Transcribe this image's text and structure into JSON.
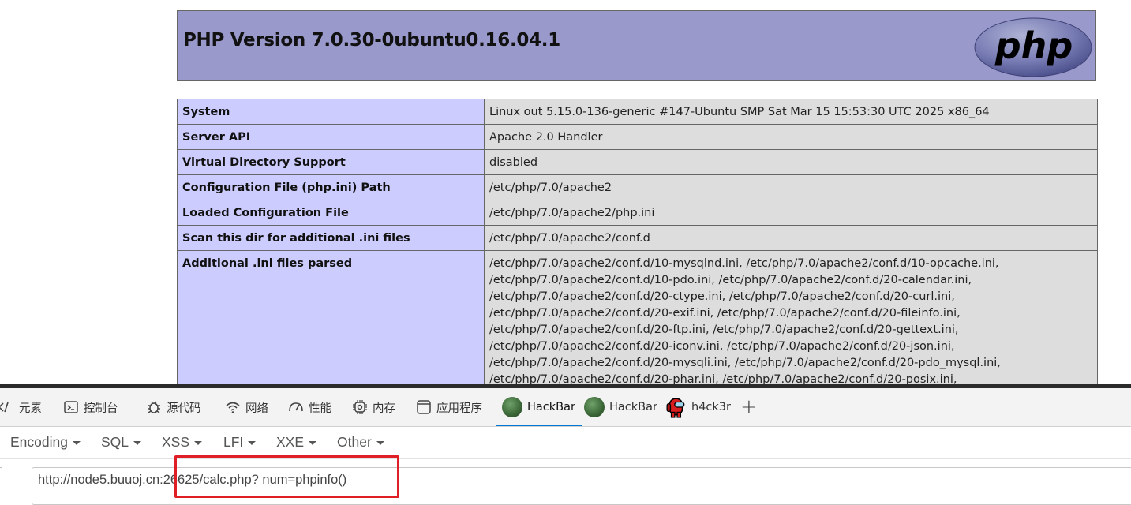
{
  "php": {
    "title": "PHP Version 7.0.30-0ubuntu0.16.04.1",
    "logo_text": "php",
    "rows": [
      {
        "key": "System",
        "value": "Linux out 5.15.0-136-generic #147-Ubuntu SMP Sat Mar 15 15:53:30 UTC 2025 x86_64"
      },
      {
        "key": "Server API",
        "value": "Apache 2.0 Handler"
      },
      {
        "key": "Virtual Directory Support",
        "value": "disabled"
      },
      {
        "key": "Configuration File (php.ini) Path",
        "value": "/etc/php/7.0/apache2"
      },
      {
        "key": "Loaded Configuration File",
        "value": "/etc/php/7.0/apache2/php.ini"
      },
      {
        "key": "Scan this dir for additional .ini files",
        "value": "/etc/php/7.0/apache2/conf.d"
      }
    ],
    "ini_parsed_key": "Additional .ini files parsed",
    "ini_parsed_lines": [
      "/etc/php/7.0/apache2/conf.d/10-mysqlnd.ini, /etc/php/7.0/apache2/conf.d/10-opcache.ini,",
      "/etc/php/7.0/apache2/conf.d/10-pdo.ini, /etc/php/7.0/apache2/conf.d/20-calendar.ini,",
      "/etc/php/7.0/apache2/conf.d/20-ctype.ini, /etc/php/7.0/apache2/conf.d/20-curl.ini,",
      "/etc/php/7.0/apache2/conf.d/20-exif.ini, /etc/php/7.0/apache2/conf.d/20-fileinfo.ini,",
      "/etc/php/7.0/apache2/conf.d/20-ftp.ini, /etc/php/7.0/apache2/conf.d/20-gettext.ini,",
      "/etc/php/7.0/apache2/conf.d/20-iconv.ini, /etc/php/7.0/apache2/conf.d/20-json.ini,",
      "/etc/php/7.0/apache2/conf.d/20-mysqli.ini, /etc/php/7.0/apache2/conf.d/20-pdo_mysql.ini,",
      "/etc/php/7.0/apache2/conf.d/20-phar.ini, /etc/php/7.0/apache2/conf.d/20-posix.ini,"
    ]
  },
  "devtools": {
    "tabs": [
      {
        "label": "元素",
        "icon": "code-icon"
      },
      {
        "label": "控制台",
        "icon": "console-icon"
      },
      {
        "label": "源代码",
        "icon": "bug-icon"
      },
      {
        "label": "网络",
        "icon": "wifi-icon"
      },
      {
        "label": "性能",
        "icon": "gauge-icon"
      },
      {
        "label": "内存",
        "icon": "chip-icon"
      },
      {
        "label": "应用程序",
        "icon": "app-icon"
      },
      {
        "label": "HackBar",
        "icon": "hackbar-icon",
        "active": true
      },
      {
        "label": "HackBar",
        "icon": "hackbar-icon"
      },
      {
        "label": "h4ck3r",
        "icon": "h4ck3r-icon"
      }
    ],
    "add_tab": "+"
  },
  "hackbar": {
    "menus": [
      "Encoding",
      "SQL",
      "XSS",
      "LFI",
      "XXE",
      "Other"
    ],
    "url": "http://node5.buuoj.cn:26625/calc.php? num=phpinfo()"
  },
  "colors": {
    "header_bg": "#9999cc",
    "key_bg": "#ccccff",
    "value_bg": "#dddddd",
    "highlight_box": "#e01e25",
    "active_tab": "#0078d4"
  }
}
